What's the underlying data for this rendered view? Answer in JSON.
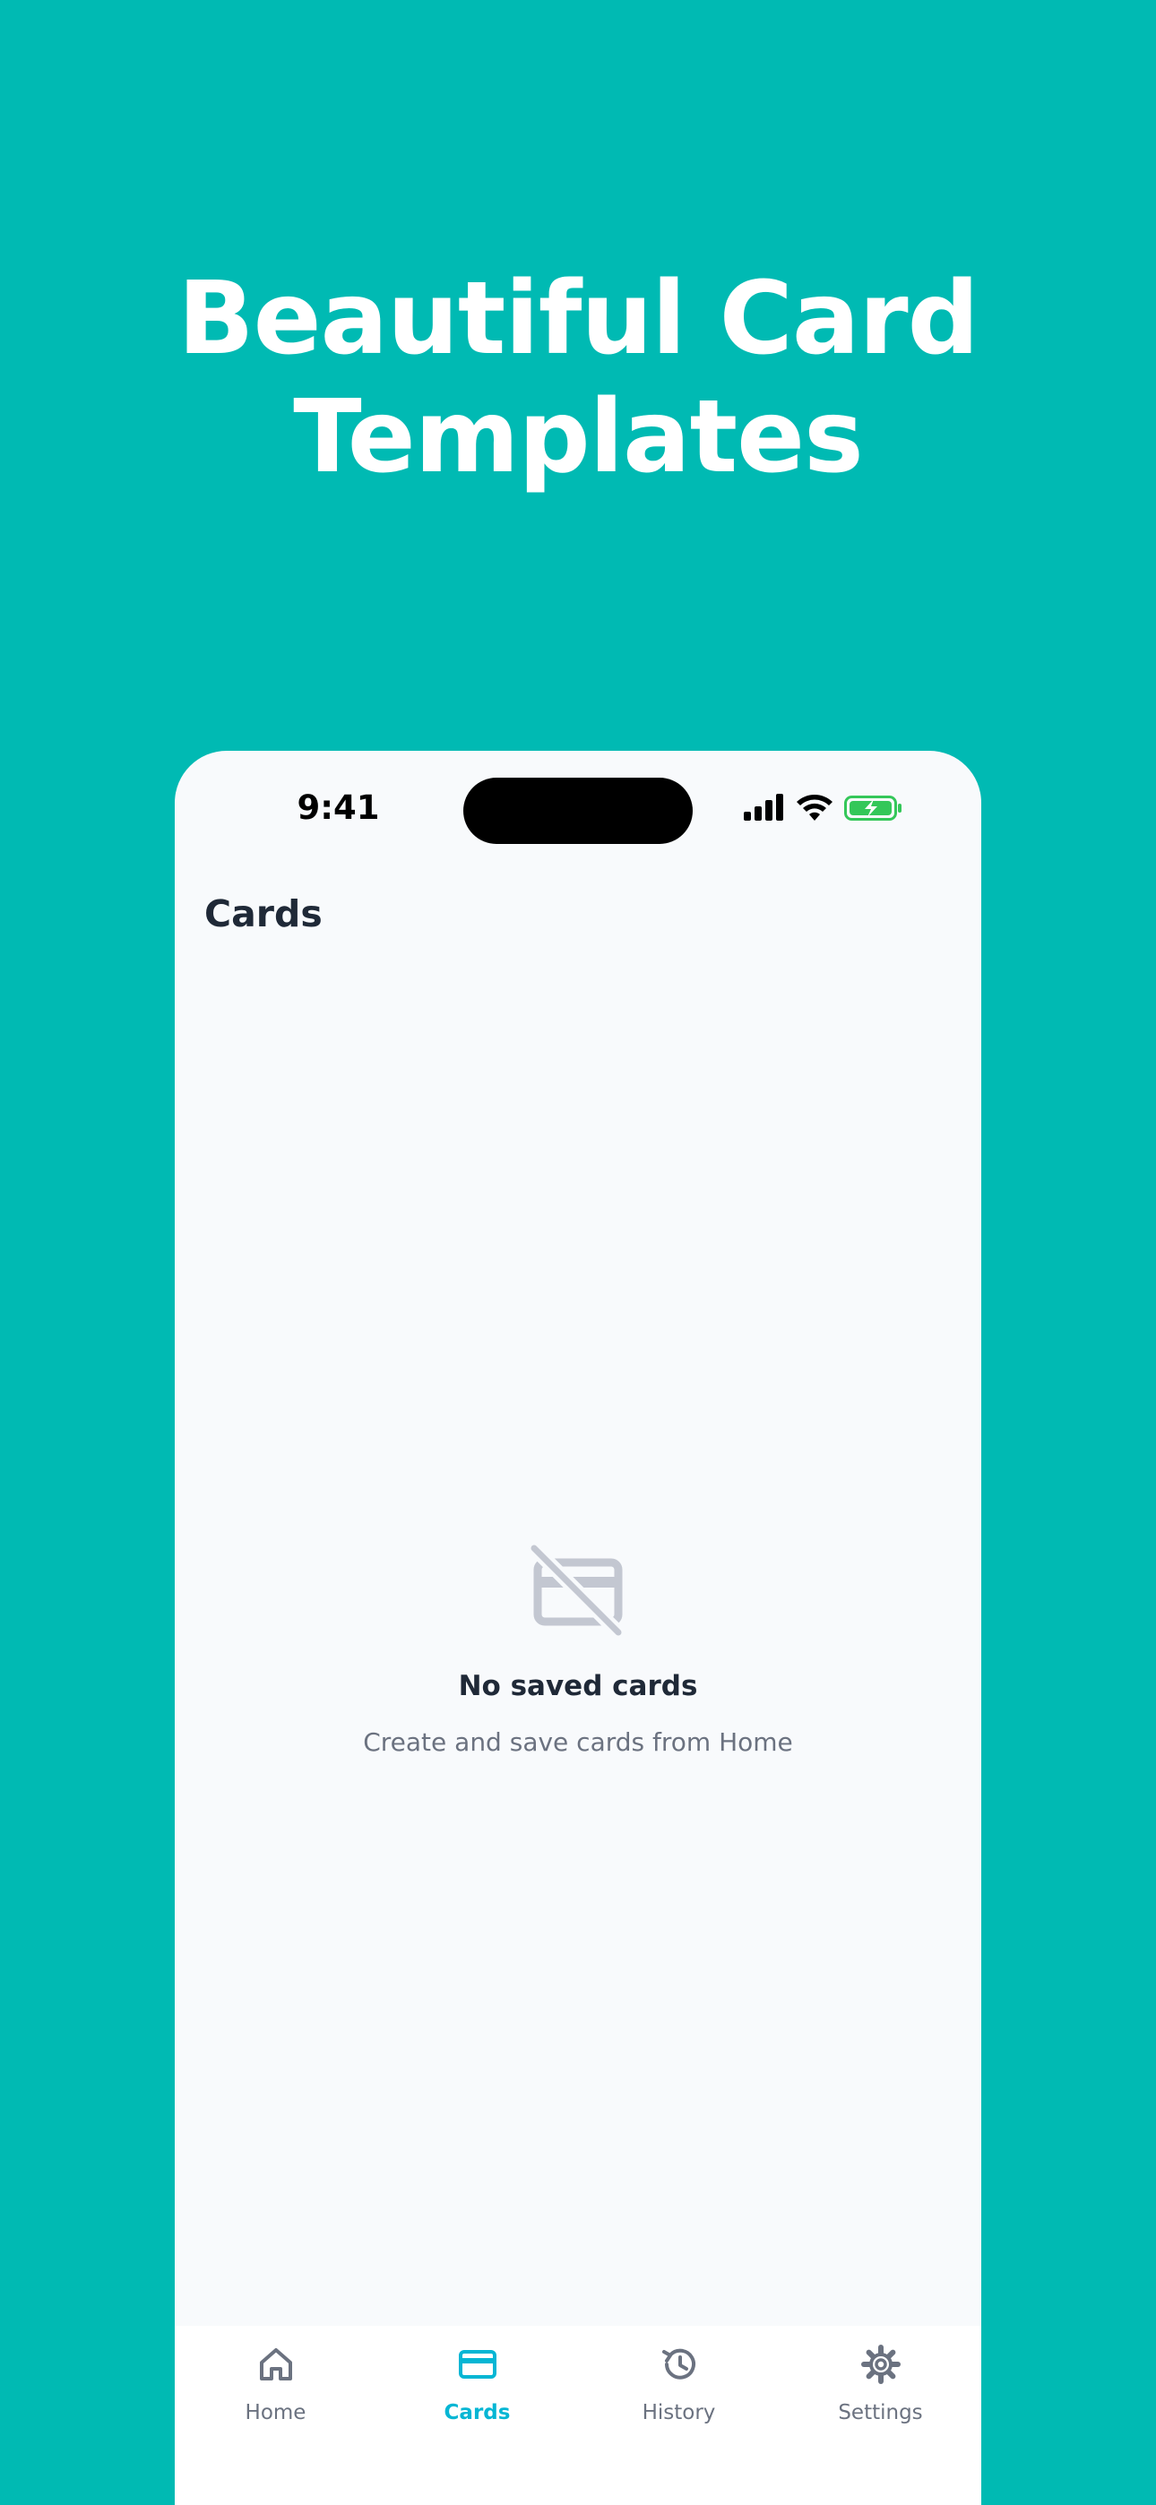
{
  "promo": {
    "headline_line1": "Beautiful Card",
    "headline_line2": "Templates"
  },
  "status_bar": {
    "time": "9:41",
    "icons": [
      "cellular-signal-icon",
      "wifi-icon",
      "battery-charging-icon"
    ]
  },
  "page": {
    "title": "Cards"
  },
  "empty_state": {
    "icon": "card-off-icon",
    "title": "No saved cards",
    "subtitle": "Create and save cards from Home"
  },
  "tab_bar": {
    "active_index": 1,
    "tabs": [
      {
        "label": "Home",
        "icon": "home-icon"
      },
      {
        "label": "Cards",
        "icon": "credit-card-icon"
      },
      {
        "label": "History",
        "icon": "history-icon"
      },
      {
        "label": "Settings",
        "icon": "gear-icon"
      }
    ]
  },
  "colors": {
    "background": "#00BAB3",
    "accent": "#06B6D4",
    "text_primary": "#1F2937",
    "text_secondary": "#6B7280",
    "battery": "#34C759"
  }
}
